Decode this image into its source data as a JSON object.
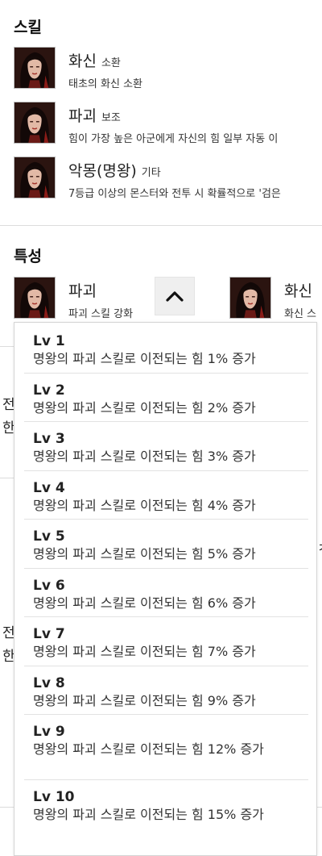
{
  "skills": {
    "title": "스킬",
    "items": [
      {
        "name": "화신",
        "tag": "소환",
        "desc": "태초의 화신 소환"
      },
      {
        "name": "파괴",
        "tag": "보조",
        "desc": "힘이 가장 높은 아군에게 자신의 힘 일부 자동 이"
      },
      {
        "name": "악몽(명왕)",
        "tag": "기타",
        "desc": "7등급 이상의 몬스터와 전투 시 확률적으로 '검은"
      }
    ]
  },
  "traits": {
    "title": "특성",
    "items": [
      {
        "name": "파괴",
        "desc": "파괴 스킬 강화"
      },
      {
        "name": "화신",
        "desc": "화신 스"
      }
    ]
  },
  "background_fragments": [
    "전",
    "한",
    "전",
    "한",
    "ㅊ"
  ],
  "dropdown": {
    "levels": [
      {
        "title": "Lv 1",
        "desc": "명왕의 파괴 스킬로 이전되는 힘 1% 증가"
      },
      {
        "title": "Lv 2",
        "desc": "명왕의 파괴 스킬로 이전되는 힘 2% 증가"
      },
      {
        "title": "Lv 3",
        "desc": "명왕의 파괴 스킬로 이전되는 힘 3% 증가"
      },
      {
        "title": "Lv 4",
        "desc": "명왕의 파괴 스킬로 이전되는 힘 4% 증가"
      },
      {
        "title": "Lv 5",
        "desc": "명왕의 파괴 스킬로 이전되는 힘 5% 증가"
      },
      {
        "title": "Lv 6",
        "desc": "명왕의 파괴 스킬로 이전되는 힘 6% 증가"
      },
      {
        "title": "Lv 7",
        "desc": "명왕의 파괴 스킬로 이전되는 힘 7% 증가"
      },
      {
        "title": "Lv 8",
        "desc": "명왕의 파괴 스킬로 이전되는 힘 9% 증가"
      },
      {
        "title": "Lv 9",
        "desc": "명왕의 파괴 스킬로 이전되는 힘 12% 증가"
      },
      {
        "title": "Lv 10",
        "desc": "명왕의 파괴 스킬로 이전되는 힘 15% 증가"
      }
    ]
  },
  "icons": {
    "avatar": "character-portrait-icon",
    "collapse": "chevron-up-icon"
  }
}
